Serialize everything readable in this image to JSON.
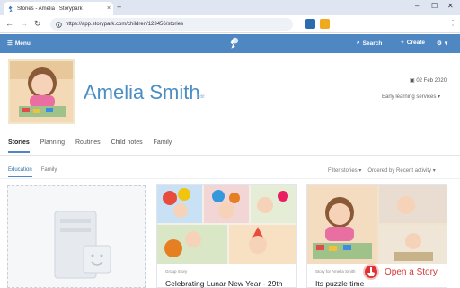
{
  "browser": {
    "tab_title": "Stories - Amelia | Storypark",
    "tab_close": "×",
    "new_tab": "+",
    "url": "https://app.storypark.com/children/123456/stories",
    "window_controls": [
      "–",
      "☐",
      "✕"
    ]
  },
  "header": {
    "menu_label": "Menu",
    "search_label": "Search",
    "create_label": "Create",
    "colors": {
      "bar": "#4f87c2"
    }
  },
  "profile": {
    "name": "Amelia Smith",
    "edit_label": "Edit",
    "dob": "02 Feb 2020",
    "services": "Early learning services"
  },
  "tabs": [
    "Stories",
    "Planning",
    "Routines",
    "Child notes",
    "Family"
  ],
  "subtabs": [
    "Education",
    "Family"
  ],
  "filters": {
    "filter": "Filter stories",
    "order": "Ordered by Recent activity"
  },
  "cards": [
    {
      "kind": "Group Story",
      "title": "Celebrating Lunar New Year - 29th"
    },
    {
      "kind": "Story for Amelia Smith",
      "title": "Its puzzle time"
    }
  ],
  "callout": {
    "label": "Open a Story"
  }
}
